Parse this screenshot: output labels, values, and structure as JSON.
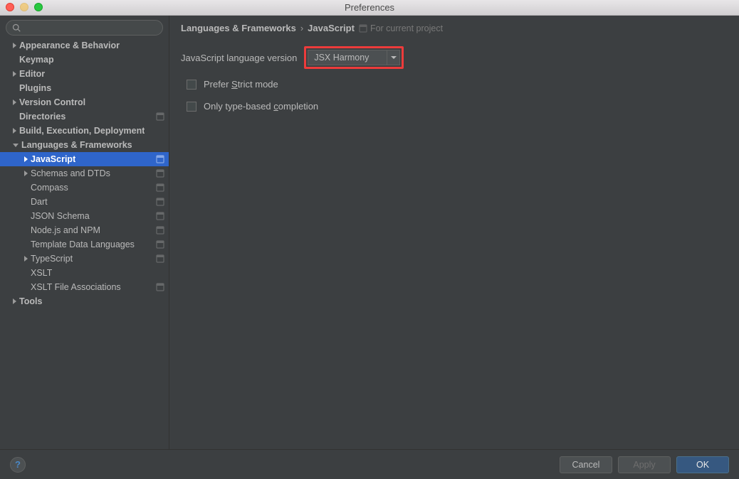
{
  "window": {
    "title": "Preferences"
  },
  "search": {
    "placeholder": ""
  },
  "tree": [
    {
      "label": "Appearance & Behavior",
      "depth": 0,
      "arrow": "right",
      "bold": true
    },
    {
      "label": "Keymap",
      "depth": 0,
      "arrow": "none",
      "bold": true
    },
    {
      "label": "Editor",
      "depth": 0,
      "arrow": "right",
      "bold": true
    },
    {
      "label": "Plugins",
      "depth": 0,
      "arrow": "none",
      "bold": true
    },
    {
      "label": "Version Control",
      "depth": 0,
      "arrow": "right",
      "bold": true
    },
    {
      "label": "Directories",
      "depth": 0,
      "arrow": "none",
      "bold": true,
      "proj": true
    },
    {
      "label": "Build, Execution, Deployment",
      "depth": 0,
      "arrow": "right",
      "bold": true
    },
    {
      "label": "Languages & Frameworks",
      "depth": 0,
      "arrow": "down",
      "bold": true
    },
    {
      "label": "JavaScript",
      "depth": 1,
      "arrow": "right",
      "bold": true,
      "selected": true,
      "proj": true
    },
    {
      "label": "Schemas and DTDs",
      "depth": 1,
      "arrow": "right",
      "proj": true
    },
    {
      "label": "Compass",
      "depth": 1,
      "arrow": "none",
      "proj": true
    },
    {
      "label": "Dart",
      "depth": 1,
      "arrow": "none",
      "proj": true
    },
    {
      "label": "JSON Schema",
      "depth": 1,
      "arrow": "none",
      "proj": true
    },
    {
      "label": "Node.js and NPM",
      "depth": 1,
      "arrow": "none",
      "proj": true
    },
    {
      "label": "Template Data Languages",
      "depth": 1,
      "arrow": "none",
      "proj": true
    },
    {
      "label": "TypeScript",
      "depth": 1,
      "arrow": "right",
      "proj": true
    },
    {
      "label": "XSLT",
      "depth": 1,
      "arrow": "none"
    },
    {
      "label": "XSLT File Associations",
      "depth": 1,
      "arrow": "none",
      "proj": true
    },
    {
      "label": "Tools",
      "depth": 0,
      "arrow": "right",
      "bold": true
    }
  ],
  "breadcrumb": {
    "seg1": "Languages & Frameworks",
    "seg2": "JavaScript",
    "hint": "For current project"
  },
  "form": {
    "lang_version_label": "JavaScript language version",
    "lang_version_value": "JSX Harmony",
    "prefer_strict_html": "Prefer <u>S</u>trict mode",
    "only_type_html": "Only type-based <u>c</u>ompletion"
  },
  "footer": {
    "help": "?",
    "cancel": "Cancel",
    "apply": "Apply",
    "ok": "OK"
  }
}
